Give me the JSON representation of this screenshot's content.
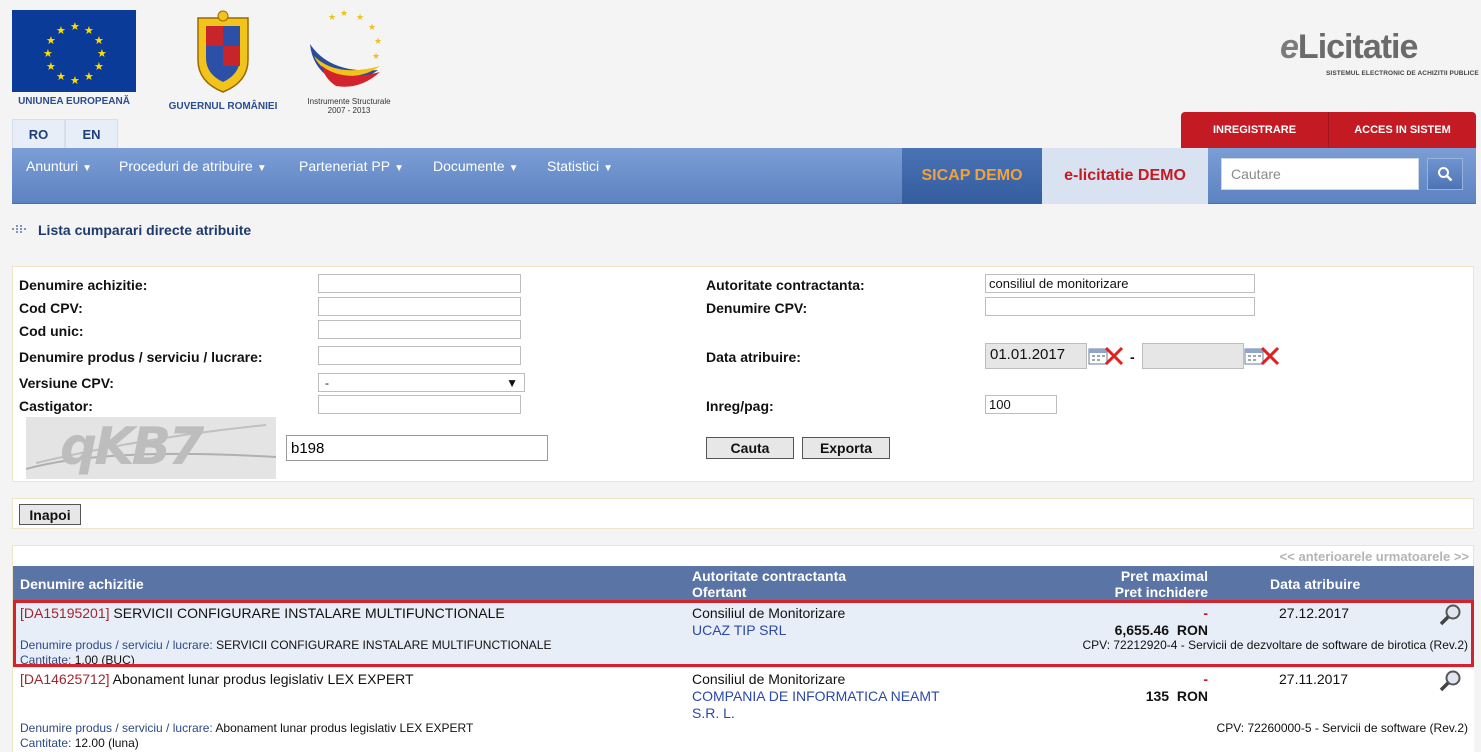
{
  "header": {
    "eu_caption": "UNIUNEA EUROPEANĂ",
    "gov_caption": "GUVERNUL ROMÂNIEI",
    "is_caption_line1": "Instrumente Structurale",
    "is_caption_line2": "2007 - 2013",
    "brand_main_e": "e",
    "brand_main": "Licitatie",
    "brand_sub": "SISTEMUL ELECTRONIC DE ACHIZITII PUBLICE"
  },
  "languages": [
    "RO",
    "EN"
  ],
  "account": {
    "register": "INREGISTRARE",
    "login": "ACCES IN SISTEM"
  },
  "nav": {
    "items": [
      "Anunturi",
      "Proceduri de atribuire",
      "Parteneriat PP",
      "Documente",
      "Statistici"
    ],
    "caret": "▼",
    "sicap": "SICAP DEMO",
    "elicitatie": "e-licitatie DEMO",
    "search_placeholder": "Cautare"
  },
  "page_title": "Lista cumparari directe atribuite",
  "filters": {
    "denumire_achizitie_label": "Denumire achizitie:",
    "denumire_achizitie_value": "",
    "cod_cpv_label": "Cod CPV:",
    "cod_cpv_value": "",
    "cod_unic_label": "Cod unic:",
    "cod_unic_value": "",
    "denumire_produs_label": "Denumire produs / serviciu / lucrare:",
    "denumire_produs_value": "",
    "versiune_cpv_label": "Versiune CPV:",
    "versiune_cpv_value": "-",
    "castigator_label": "Castigator:",
    "castigator_value": "",
    "autoritate_label": "Autoritate contractanta:",
    "autoritate_value": "consiliul de monitorizare",
    "denumire_cpv_label": "Denumire CPV:",
    "denumire_cpv_value": "",
    "data_atribuire_label": "Data atribuire:",
    "data_from": "01.01.2017",
    "date_sep": "-",
    "data_to": "",
    "inreg_pag_label": "Inreg/pag:",
    "inreg_pag_value": "100",
    "captcha_text": "qKB7",
    "captcha_input": "b198",
    "search_button": "Cauta",
    "export_button": "Exporta"
  },
  "back_button": "Inapoi",
  "results": {
    "pager": "<< anterioarele urmatoarele >>",
    "headers": {
      "denumire": "Denumire achizitie",
      "autoritate": "Autoritate contractanta",
      "ofertant": "Ofertant",
      "pret_max": "Pret maximal",
      "pret_inchidere": "Pret inchidere",
      "data": "Data atribuire"
    },
    "produs_label": "Denumire produs / serviciu / lucrare:",
    "cantitate_label": "Cantitate:",
    "rows": [
      {
        "code": "[DA15195201]",
        "title": "SERVICII CONFIGURARE INSTALARE MULTIFUNCTIONALE",
        "autoritate": "Consiliul de Monitorizare",
        "ofertant": "UCAZ TIP SRL",
        "pret_max": "-",
        "pret_inchidere": "6,655.46",
        "currency": "RON",
        "data": "27.12.2017",
        "produs": "SERVICII CONFIGURARE INSTALARE MULTIFUNCTIONALE",
        "cantitate": "1.00 (BUC)",
        "cpv": "CPV: 72212920-4 - Servicii de dezvoltare de software de birotica (Rev.2)"
      },
      {
        "code": "[DA14625712]",
        "title": "Abonament lunar produs legislativ LEX EXPERT",
        "autoritate": "Consiliul de Monitorizare",
        "ofertant_line1": "COMPANIA DE INFORMATICA NEAMT",
        "ofertant_line2": "S.R. L.",
        "pret_max": "-",
        "pret_inchidere": "135",
        "currency": "RON",
        "data": "27.11.2017",
        "produs": "Abonament lunar produs legislativ LEX EXPERT",
        "cantitate": "12.00 (luna)",
        "cpv": "CPV: 72260000-5 - Servicii de software (Rev.2)"
      }
    ]
  },
  "colors": {
    "nav_blue": "#6a8ecb",
    "accent_red": "#c31a23",
    "sicap_orange": "#f3a13a",
    "table_header": "#5a74a5",
    "highlight_border": "#d2232e"
  }
}
